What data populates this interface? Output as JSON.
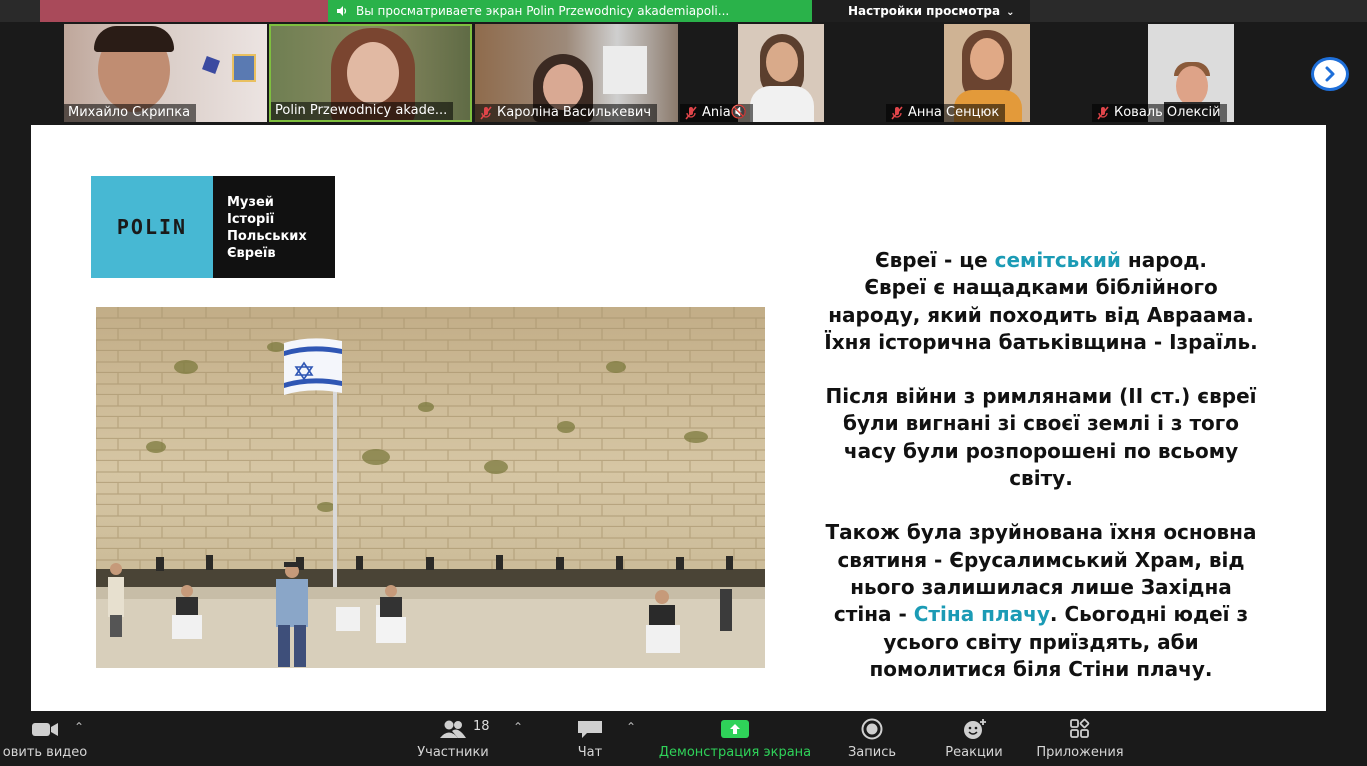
{
  "share_banner": {
    "text": "Вы  просматриваете экран Polin Przewodnicy akademiapoli..."
  },
  "view_settings": {
    "label": "Настройки просмотра",
    "chevron": "chevron-down-icon"
  },
  "participants_strip": [
    {
      "name": "Михайло Скрипка",
      "muted": false
    },
    {
      "name": "Polin Przewodnicy akade...",
      "muted": false
    },
    {
      "name": "Кароліна Василькевич",
      "muted": true
    },
    {
      "name": "Ania🔇",
      "muted": true
    },
    {
      "name": "Анна Сенцюк",
      "muted": true
    },
    {
      "name": "Коваль Олексій",
      "muted": true
    }
  ],
  "slide": {
    "logo": {
      "brand": "POLIN",
      "lines": [
        "Музей",
        "Історії",
        "Польських",
        "Євреїв"
      ]
    },
    "paragraph1": [
      {
        "pre": "Євреї - це ",
        "hl": "семітський",
        "post": " народ."
      },
      {
        "pre": "Євреї є нащадками біблійного",
        "hl": "",
        "post": ""
      },
      {
        "pre": "народу, який походить від Авраама.",
        "hl": "",
        "post": ""
      },
      {
        "pre": "Їхня історична батьківщина - Ізраїль.",
        "hl": "",
        "post": ""
      }
    ],
    "paragraph2": [
      "Після війни з римлянами (ІІ ст.) євреї",
      "були вигнані зі своєї землі і з того",
      "часу були розпорошені по всьому",
      "світу."
    ],
    "paragraph3": [
      {
        "pre": "Також була зруйнована їхня основна",
        "hl": "",
        "post": ""
      },
      {
        "pre": "святиня - Єрусалимський Храм, від",
        "hl": "",
        "post": ""
      },
      {
        "pre": "нього залишилася лише Західна",
        "hl": "",
        "post": ""
      },
      {
        "pre": "стіна - ",
        "hl": "Стіна плачу",
        "post": ". Сьогодні юдеї з"
      },
      {
        "pre": "усього світу приїздять, аби",
        "hl": "",
        "post": ""
      },
      {
        "pre": "помолитися біля Стіни плачу.",
        "hl": "",
        "post": ""
      }
    ],
    "highlight_color": "#1b9bb5"
  },
  "toolbar": {
    "video": {
      "label": "овить видео"
    },
    "participants": {
      "label": "Участники",
      "count": "18"
    },
    "chat": {
      "label": "Чат"
    },
    "share": {
      "label": "Демонстрация экрана",
      "color": "#2fd259"
    },
    "record": {
      "label": "Запись"
    },
    "reactions": {
      "label": "Реакции"
    },
    "apps": {
      "label": "Приложения"
    }
  }
}
